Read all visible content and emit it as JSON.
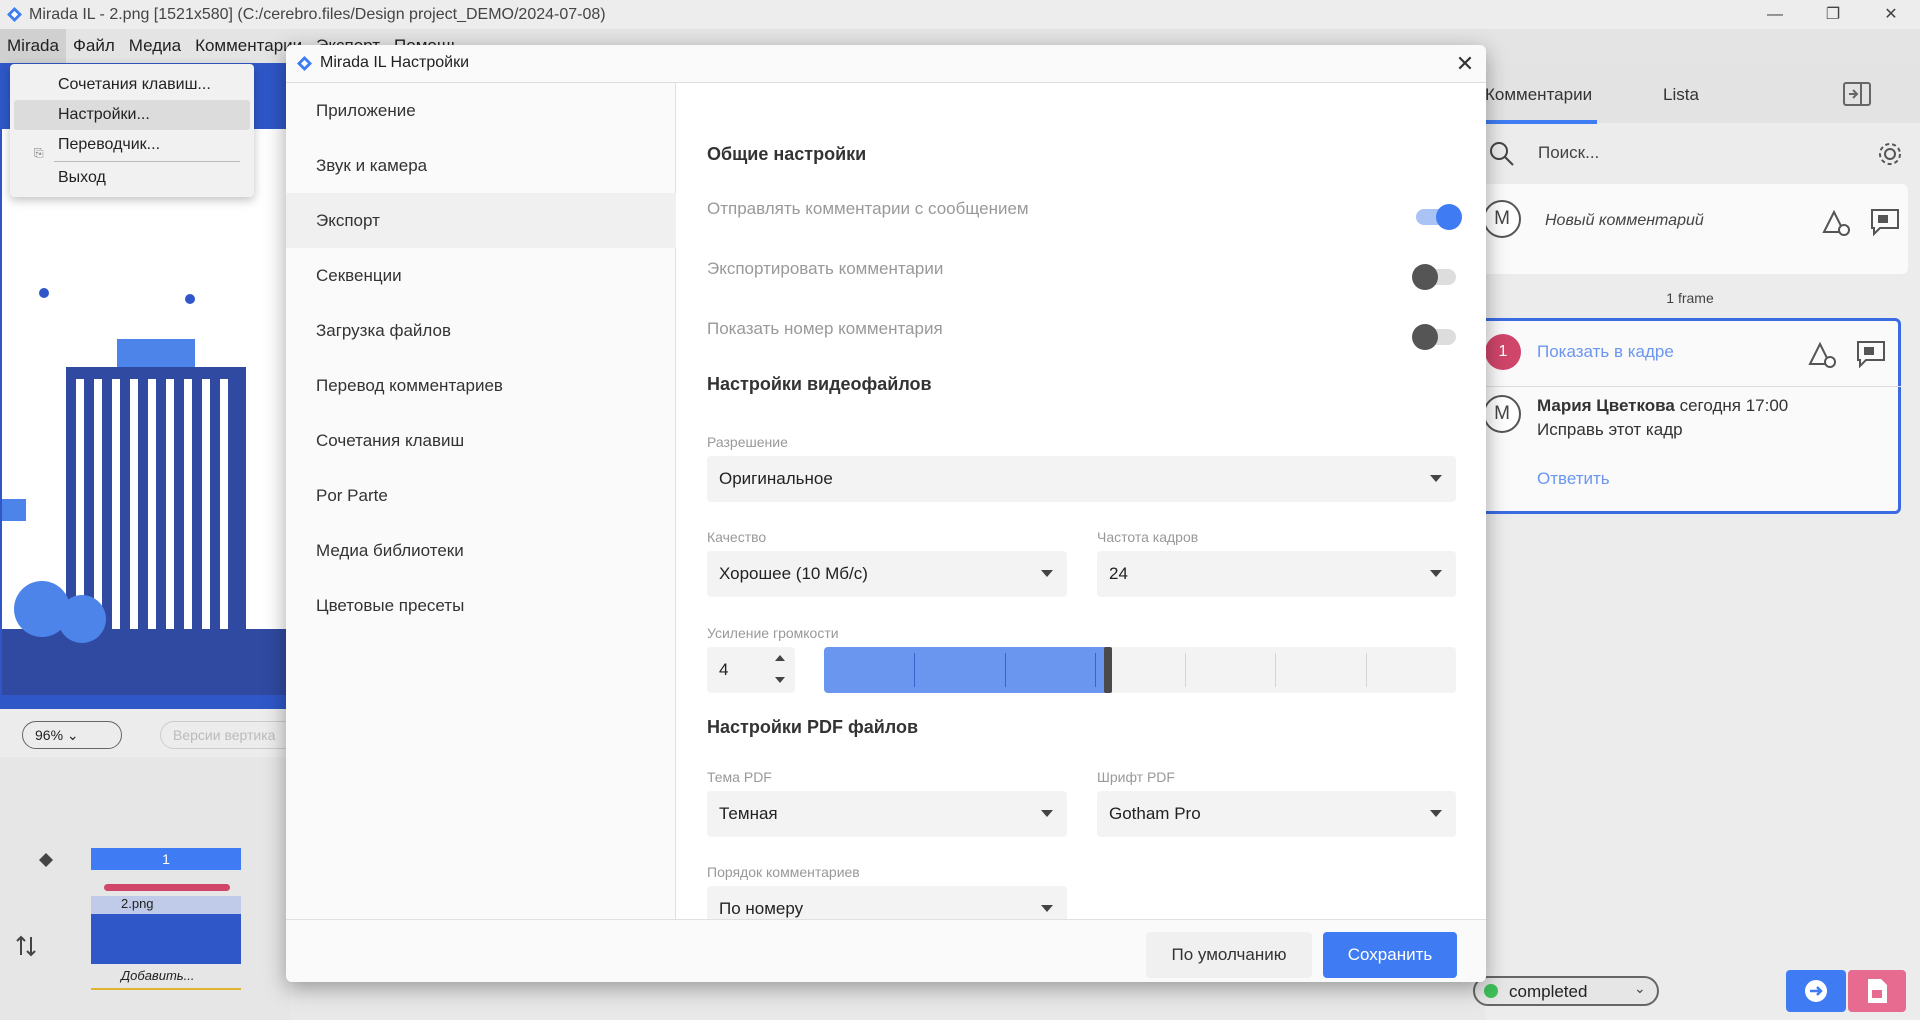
{
  "window": {
    "title": "Mirada IL - 2.png [1521x580] (C:/cerebro.files/Design project_DEMO/2024-07-08)",
    "minimize": "—",
    "restore": "❐",
    "close": "✕"
  },
  "menubar": {
    "items": [
      "Mirada",
      "Файл",
      "Медиа",
      "Комментарии",
      "Экспорт",
      "Помощь"
    ]
  },
  "app_menu": {
    "items": [
      {
        "label": "Сочетания клавиш..."
      },
      {
        "label": "Настройки..."
      },
      {
        "label": "Переводчик..."
      },
      {
        "label": "Выход"
      }
    ]
  },
  "left_panel": {
    "zoom": "96%",
    "versions_placeholder": "Версии вертика",
    "timeline_frame": "1",
    "clip_name": "2.png",
    "add_label": "Добавить..."
  },
  "comments_panel": {
    "tabs": [
      "Комментарии",
      "Lista"
    ],
    "search_placeholder": "Поиск...",
    "new_comment_avatar": "M",
    "new_comment_placeholder": "Новый комментарий",
    "frame_label": "1 frame",
    "comment": {
      "number": "1",
      "show_in_frame": "Показать в кадре",
      "avatar": "M",
      "author": "Мария Цветкова",
      "time": "сегодня 17:00",
      "text": "Исправь этот кадр",
      "reply": "Ответить"
    },
    "status": "completed",
    "status_color": "#3fc05a"
  },
  "settings_dialog": {
    "title": "Mirada IL Настройки",
    "close_label": "✕",
    "nav": [
      {
        "label": "Приложение"
      },
      {
        "label": "Звук и камера"
      },
      {
        "label": "Экспорт"
      },
      {
        "label": "Секвенции"
      },
      {
        "label": "Загрузка файлов"
      },
      {
        "label": "Перевод комментариев"
      },
      {
        "label": "Сочетания клавиш"
      },
      {
        "label": "Por Parte"
      },
      {
        "label": "Медиа библиотеки"
      },
      {
        "label": "Цветовые пресеты"
      }
    ],
    "active_nav": "Экспорт",
    "general": {
      "heading": "Общие настройки",
      "send_with_message": {
        "label": "Отправлять комментарии с сообщением",
        "on": true
      },
      "export_comments": {
        "label": "Экспортировать комментарии",
        "on": false
      },
      "show_number": {
        "label": "Показать номер комментария",
        "on": false
      }
    },
    "video": {
      "heading": "Настройки видеофайлов",
      "resolution_label": "Разрешение",
      "resolution_value": "Оригинальное",
      "quality_label": "Качество",
      "quality_value": "Хорошее (10 Мб/с)",
      "fps_label": "Частота кадров",
      "fps_value": "24",
      "volume_label": "Усиление громкости",
      "volume_value": "4",
      "volume_level": 0.45
    },
    "pdf": {
      "heading": "Настройки PDF файлов",
      "theme_label": "Тема PDF",
      "theme_value": "Темная",
      "font_label": "Шрифт PDF",
      "font_value": "Gotham Pro",
      "order_label": "Порядок комментариев",
      "order_value": "По номеру"
    },
    "buttons": {
      "default": "По умолчанию",
      "save": "Сохранить"
    },
    "accent": "#3f7cf3"
  }
}
